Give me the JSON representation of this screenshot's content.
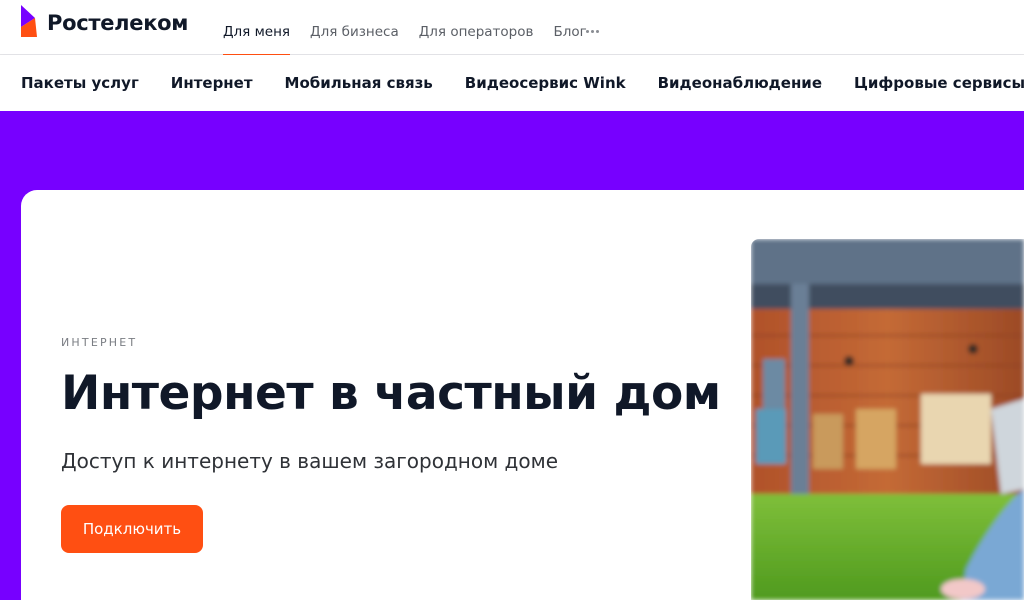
{
  "brand": {
    "name": "Ростелеком"
  },
  "header": {
    "audience_tabs": [
      "Для меня",
      "Для бизнеса",
      "Для операторов",
      "Блог"
    ],
    "active_audience": "Для меня",
    "more_icon": "more-dots-icon"
  },
  "main_nav": {
    "items": [
      "Пакеты услуг",
      "Интернет",
      "Мобильная связь",
      "Видеосервис Wink",
      "Видеонаблюдение",
      "Цифровые сервисы"
    ]
  },
  "hero": {
    "eyebrow": "ИНТЕРНЕТ",
    "title": "Интернет в частный дом",
    "subtitle": "Доступ к интернету в вашем загородном доме",
    "cta_label": "Подключить"
  },
  "colors": {
    "brand_purple": "#7700ff",
    "accent_orange": "#ff4f12",
    "text_dark": "#101828"
  }
}
